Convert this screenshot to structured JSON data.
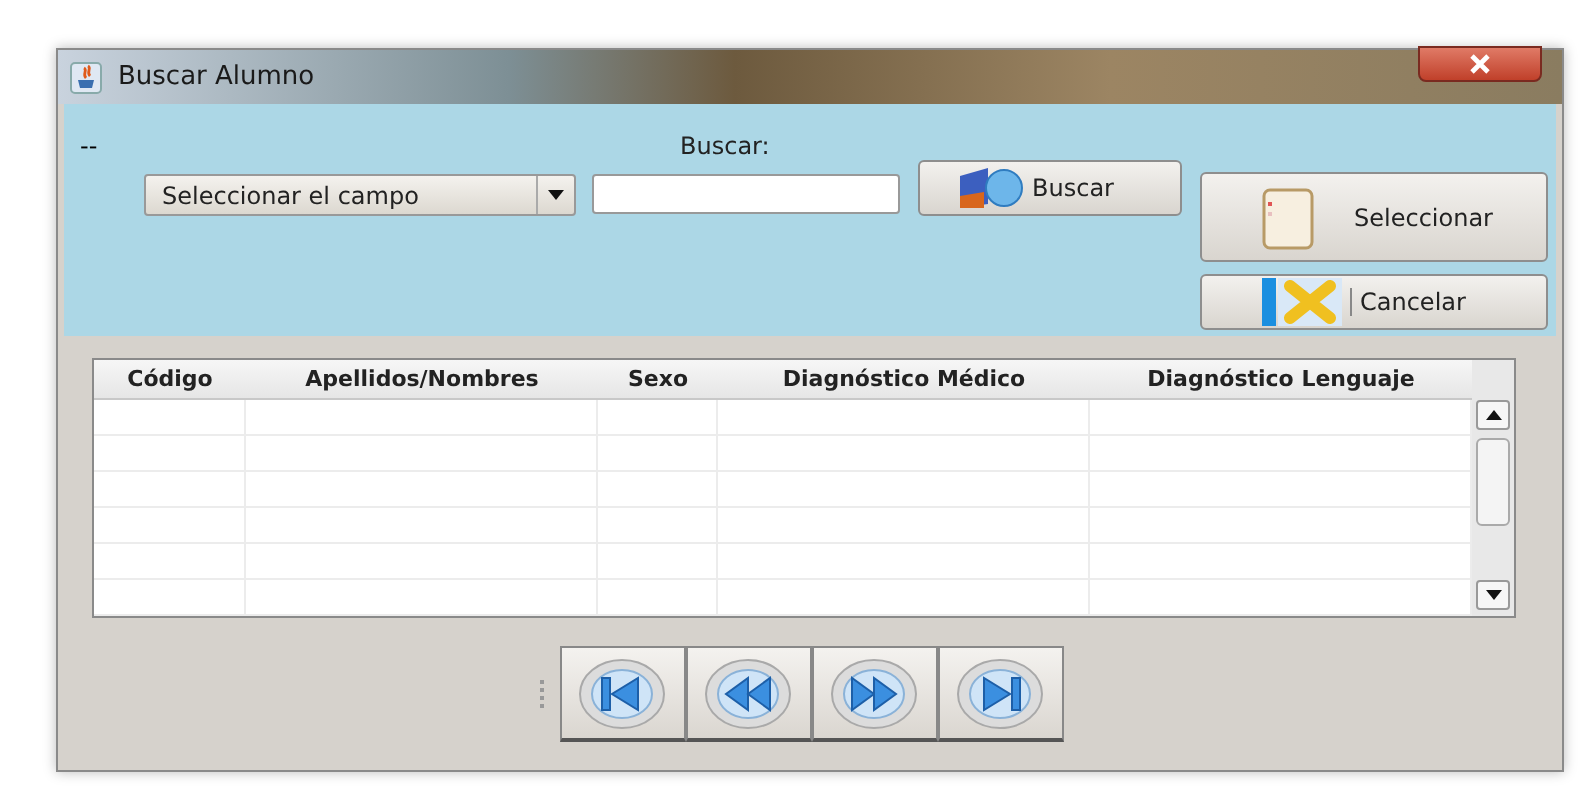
{
  "window": {
    "title": "Buscar Alumno"
  },
  "search_panel": {
    "status": "--",
    "label": "Buscar:",
    "field_combo": {
      "value": "Seleccionar el campo"
    },
    "search_button": "Buscar"
  },
  "actions": [
    {
      "kind": "select",
      "label": "Seleccionar"
    },
    {
      "kind": "cancel",
      "label": "Cancelar"
    }
  ],
  "table": {
    "columns": [
      "Código",
      "Apellidos/Nombres",
      "Sexo",
      "Diagnóstico Médico",
      "Diagnóstico Lenguaje"
    ]
  },
  "navigation": [
    {
      "kind": "first"
    },
    {
      "kind": "previous"
    },
    {
      "kind": "next"
    },
    {
      "kind": "last"
    }
  ]
}
